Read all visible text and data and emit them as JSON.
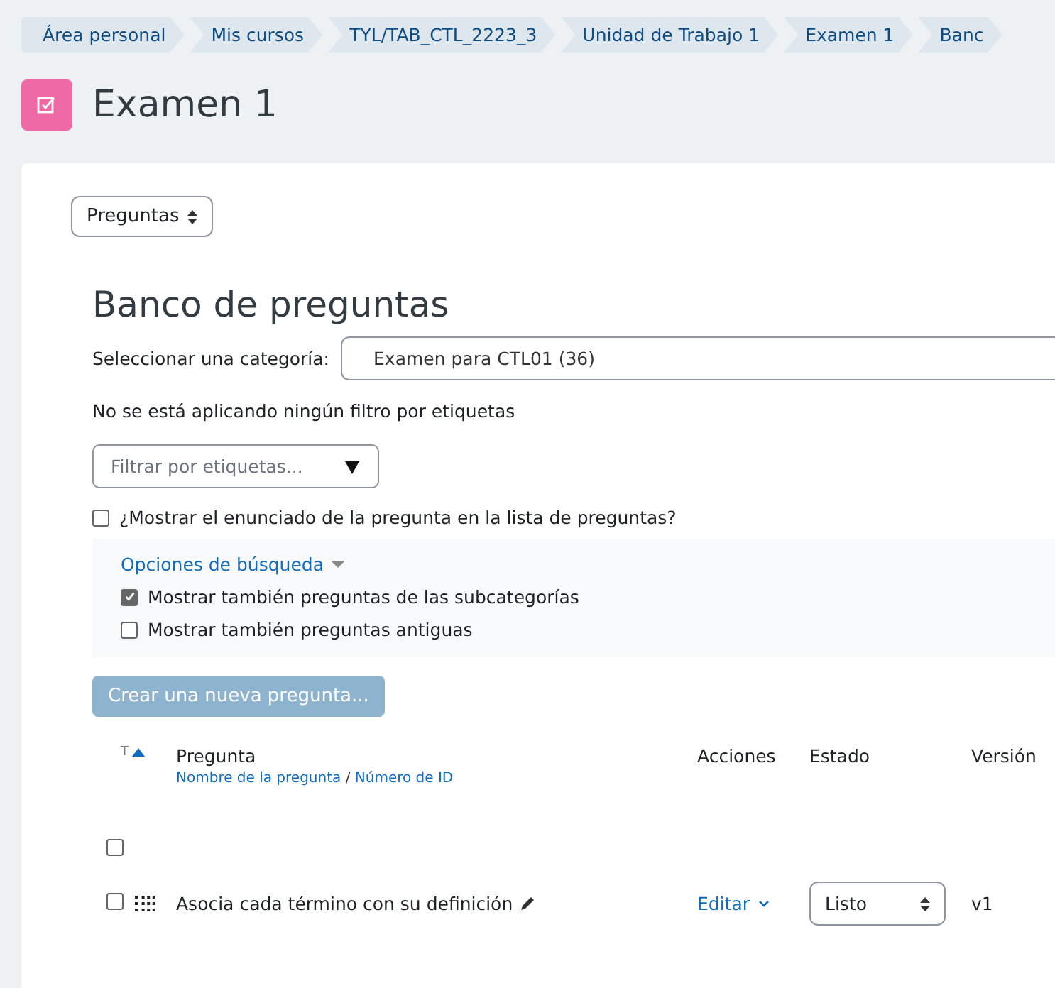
{
  "breadcrumbs": [
    "Área personal",
    "Mis cursos",
    "TYL/TAB_CTL_2223_3",
    "Unidad de Trabajo 1",
    "Examen 1",
    "Banc"
  ],
  "page_title": "Examen 1",
  "nav_select": {
    "value": "Preguntas"
  },
  "heading": "Banco de preguntas",
  "category": {
    "label": "Seleccionar una categoría:",
    "value": "Examen para CTL01 (36)"
  },
  "tag_filter_note": "No se está aplicando ningún filtro por etiquetas",
  "tag_filter": {
    "placeholder": "Filtrar por etiquetas..."
  },
  "show_text": {
    "label": "¿Mostrar el enunciado de la pregunta en la lista de preguntas?",
    "checked": false
  },
  "search_options": {
    "title": "Opciones de búsqueda",
    "expanded": true,
    "options": [
      {
        "label": "Mostrar también preguntas de las subcategorías",
        "checked": true
      },
      {
        "label": "Mostrar también preguntas antiguas",
        "checked": false
      }
    ]
  },
  "create_button": "Crear una nueva pregunta...",
  "table": {
    "columns": {
      "type": "T",
      "question": "Pregunta",
      "sort_name": "Nombre de la pregunta",
      "sort_sep": "/",
      "sort_id": "Número de ID",
      "actions": "Acciones",
      "status": "Estado",
      "version": "Versión"
    },
    "select_all": {
      "checked": false
    },
    "rows": [
      {
        "checked": false,
        "name": "Asocia cada término con su definición",
        "action": "Editar",
        "status": "Listo",
        "version": "v1"
      }
    ]
  }
}
